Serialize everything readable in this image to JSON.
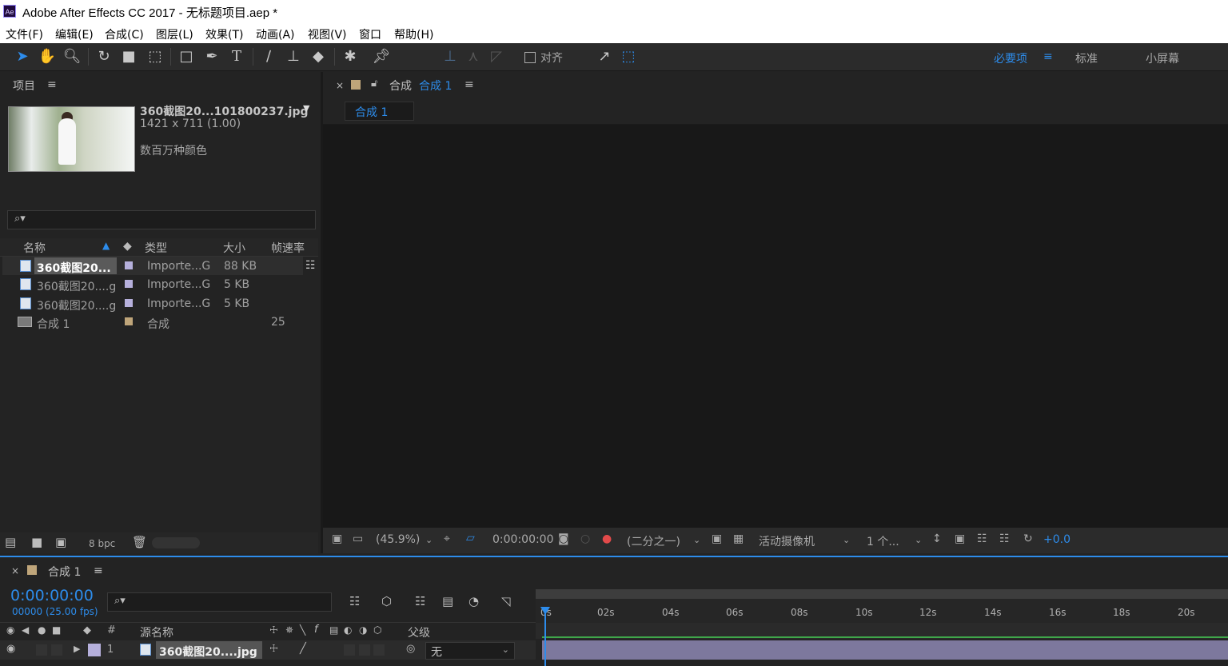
{
  "window": {
    "title": "Adobe After Effects CC 2017 - 无标题项目.aep *",
    "app_icon": "Ae"
  },
  "menu": [
    "文件(F)",
    "编辑(E)",
    "合成(C)",
    "图层(L)",
    "效果(T)",
    "动画(A)",
    "视图(V)",
    "窗口",
    "帮助(H)"
  ],
  "toolbar": {
    "align_label": "对齐",
    "workspaces": [
      "必要项",
      "标准",
      "小屏幕"
    ],
    "active_workspace_color": "#2d8ceb"
  },
  "project": {
    "panel_title": "项目",
    "selected_name": "360截图20...101800237.jpg",
    "selected_dims": "1421 x 711 (1.00)",
    "selected_colors": "数百万种颜色",
    "search_placeholder": "",
    "columns": [
      "名称",
      "类型",
      "大小",
      "帧速率"
    ],
    "items": [
      {
        "name": "360截图20...",
        "type": "Importe...G",
        "size": "88 KB",
        "fps": "",
        "kind": "image",
        "label_color": "#b6b0dc"
      },
      {
        "name": "360截图20....g",
        "type": "Importe...G",
        "size": "5 KB",
        "fps": "",
        "kind": "image",
        "label_color": "#b6b0dc"
      },
      {
        "name": "360截图20....g",
        "type": "Importe...G",
        "size": "5 KB",
        "fps": "",
        "kind": "image",
        "label_color": "#b6b0dc"
      },
      {
        "name": "合成 1",
        "type": "合成",
        "size": "",
        "fps": "25",
        "kind": "comp",
        "label_color": "#bfa57a"
      }
    ],
    "bpc": "8 bpc"
  },
  "viewer": {
    "tab_prefix": "合成",
    "tab_name": "合成 1",
    "subtab": "合成 1",
    "zoom": "(45.9%)",
    "timecode": "0:00:00:00",
    "resolution": "(二分之一)",
    "camera": "活动摄像机",
    "views": "1 个...",
    "exposure": "+0.0"
  },
  "timeline": {
    "tab": "合成 1",
    "timecode": "0:00:00:00",
    "frame_info": "00000 (25.00 fps)",
    "columns": {
      "num": "#",
      "source": "源名称",
      "parent": "父级"
    },
    "ruler": [
      "0s",
      "02s",
      "04s",
      "06s",
      "08s",
      "10s",
      "12s",
      "14s",
      "16s",
      "18s",
      "20s"
    ],
    "layer": {
      "index": "1",
      "name": "360截图20....jpg",
      "parent": "无"
    }
  }
}
